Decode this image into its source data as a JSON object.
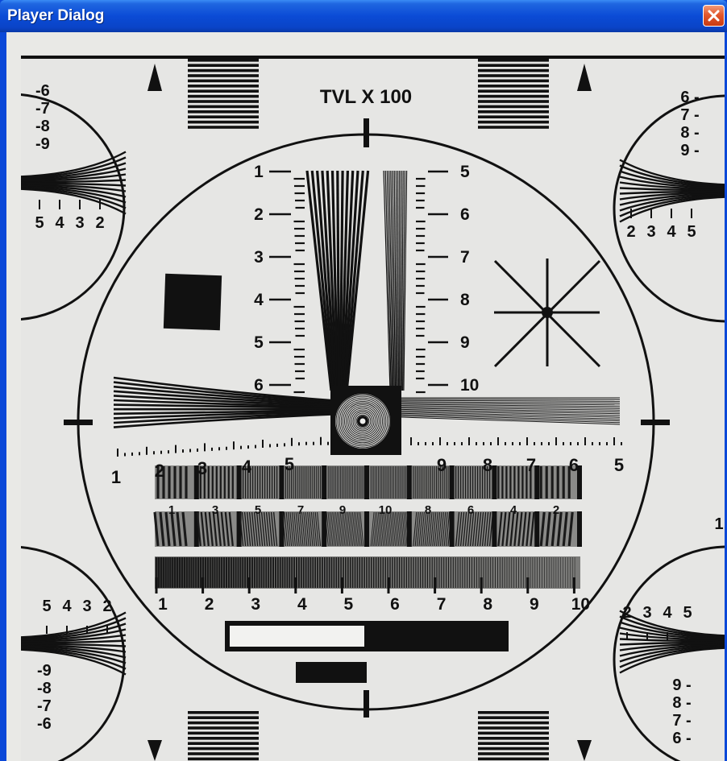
{
  "window": {
    "title": "Player Dialog"
  },
  "icons": {
    "close": "close-icon"
  },
  "colors": {
    "titlebar": "#0a48d8",
    "close_button": "#e2582e",
    "chart_ink": "#111111",
    "chart_background": "#e6e6e4"
  },
  "test_chart": {
    "title": "TVL X 100",
    "ladder_left": [
      "1",
      "2",
      "3",
      "4",
      "5",
      "6"
    ],
    "ladder_right": [
      "5",
      "6",
      "7",
      "8",
      "9",
      "10"
    ],
    "horiz_scale_left": [
      "1",
      "2",
      "3",
      "4",
      "5"
    ],
    "horiz_scale_right": [
      "9",
      "8",
      "7",
      "6",
      "5"
    ],
    "gray_bar_1": [
      "1",
      "3",
      "5",
      "7",
      "9",
      "10",
      "8",
      "6",
      "4",
      "2"
    ],
    "res_bar_scale": [
      "1",
      "2",
      "3",
      "4",
      "5",
      "6",
      "7",
      "8",
      "9",
      "10"
    ],
    "tl_corner_top": [
      "-6",
      "-7",
      "-8",
      "-9"
    ],
    "tl_corner_bottom": [
      "5",
      "4",
      "3",
      "2"
    ],
    "tr_corner_top": [
      "6 -",
      "7 -",
      "8 -",
      "9 -"
    ],
    "tr_corner_bottom": [
      "2",
      "3",
      "4",
      "5"
    ],
    "bl_corner_top": [
      "5",
      "4",
      "3",
      "2"
    ],
    "bl_corner_bottom": [
      "-9",
      "-8",
      "-7",
      "-6"
    ],
    "br_corner_top": [
      "2",
      "3",
      "4",
      "5"
    ],
    "br_corner_bottom": [
      "9 -",
      "8 -",
      "7 -",
      "6 -"
    ],
    "br_edge_mark": "1"
  }
}
